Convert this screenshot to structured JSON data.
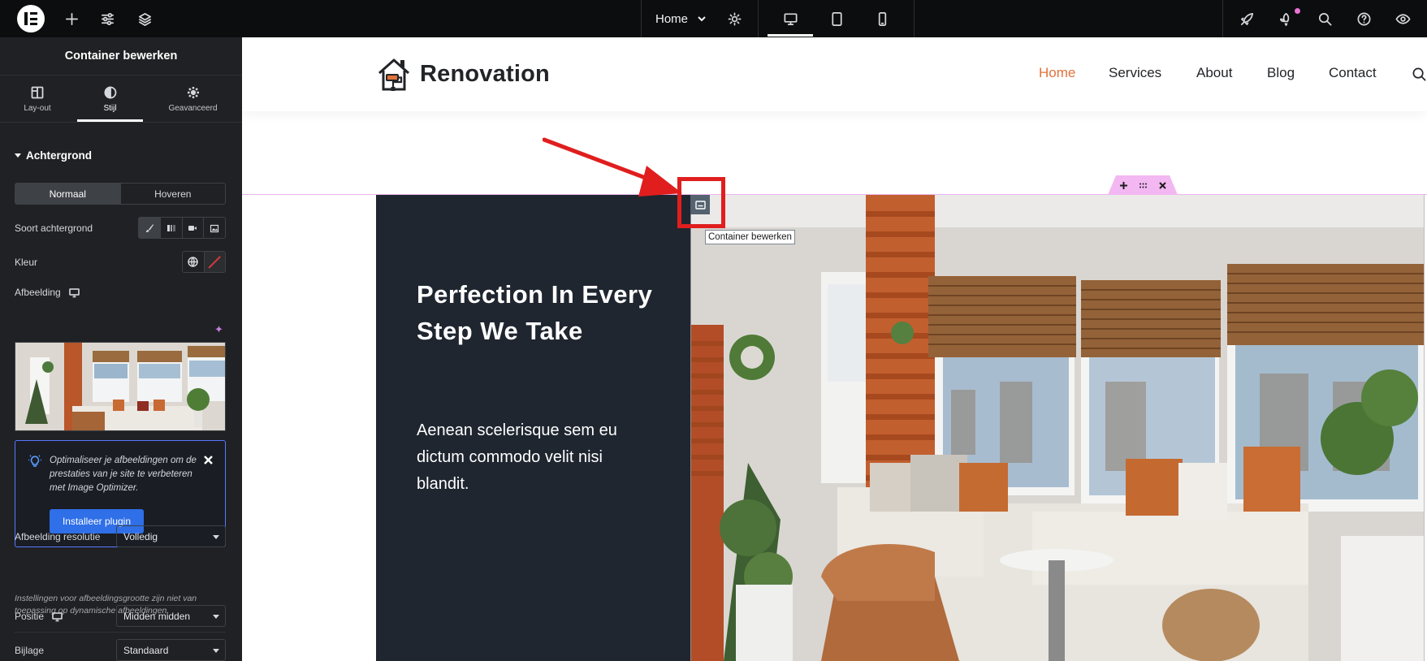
{
  "topbar": {
    "page_name": "Home",
    "icons": {
      "add": "plus-icon",
      "settings": "sliders-icon",
      "structure": "layers-icon",
      "page_settings": "gear-icon",
      "desktop": "desktop-icon",
      "tablet": "tablet-icon",
      "mobile": "mobile-icon",
      "launchpad": "rocket-icon",
      "whats_new": "gift-icon",
      "finder": "search-icon",
      "help": "help-icon",
      "preview": "eye-icon"
    }
  },
  "panel": {
    "title": "Container bewerken",
    "tabs": [
      {
        "label": "Lay-out",
        "icon": "layout-icon"
      },
      {
        "label": "Stijl",
        "icon": "contrast-icon"
      },
      {
        "label": "Geavanceerd",
        "icon": "gear-icon"
      }
    ],
    "section": "Achtergrond",
    "state_normal": "Normaal",
    "state_hover": "Hoveren",
    "bg_type_label": "Soort achtergrond",
    "color_label": "Kleur",
    "image_label": "Afbeelding",
    "promo": {
      "text": "Optimaliseer je afbeeldingen om de prestaties van je site te verbeteren met Image Optimizer.",
      "button": "Installeer plugin"
    },
    "resolution_label": "Afbeelding resolutie",
    "resolution_value": "Volledig",
    "resolution_note": "Instellingen voor afbeeldingsgrootte zijn niet van toepassing op dynamische afbeeldingen.",
    "position_label": "Positie",
    "position_value": "Midden midden",
    "attachment_label": "Bijlage",
    "attachment_value": "Standaard"
  },
  "site": {
    "brand": "Renovation",
    "nav": [
      "Home",
      "Services",
      "About",
      "Blog",
      "Contact"
    ],
    "accent_color": "#e0733b",
    "hero_title": "Perfection In Every Step We Take",
    "hero_text": "Aenean scelerisque sem eu dictum commodo velit nisi blandit."
  },
  "editor_overlay": {
    "tooltip": "Container bewerken",
    "annotation_color": "#e01e1e"
  }
}
